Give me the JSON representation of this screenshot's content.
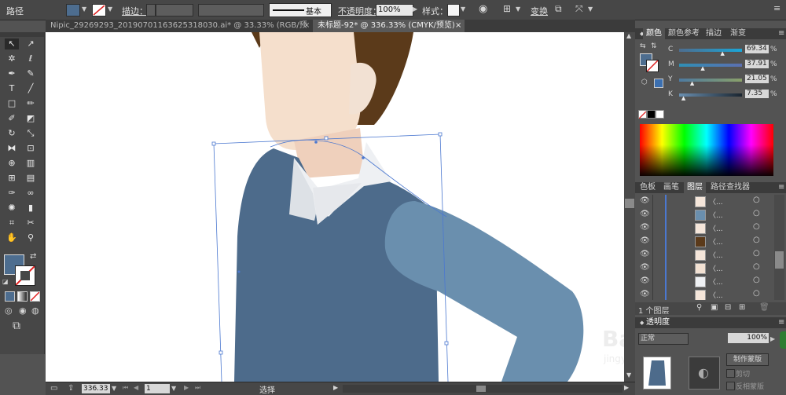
{
  "colors": {
    "accent_orange": "#f29a3a",
    "fill_swatch": "#4d6d8f",
    "sweater": "#4d6b8b",
    "sleeve": "#6a8fae",
    "hair": "#5b3a1a",
    "skin": "#f5dfcc",
    "collar": "#eef0f3",
    "selection": "#4b78d0"
  },
  "control_bar": {
    "object_type": "路径",
    "stroke_label": "描边：",
    "stroke_style": "基本",
    "opacity_label": "不透明度：",
    "opacity_value": "100%",
    "style_label": "样式：",
    "transform_label": "变换"
  },
  "tabs": [
    {
      "label": "Nipic_29269293_20190701163625318030.ai* @ 33.33% (RGB/预览)",
      "active": false
    },
    {
      "label": "未标题-92* @ 336.33% (CMYK/预览)",
      "active": true
    }
  ],
  "tools": [
    {
      "icon": "selection-tool-icon",
      "glyph": "↖"
    },
    {
      "icon": "direct-selection-tool-icon",
      "glyph": "↗"
    },
    {
      "icon": "magic-wand-tool-icon",
      "glyph": "✲"
    },
    {
      "icon": "lasso-tool-icon",
      "glyph": "ℓ"
    },
    {
      "icon": "pen-tool-icon",
      "glyph": "✒"
    },
    {
      "icon": "curvature-tool-icon",
      "glyph": "✎"
    },
    {
      "icon": "type-tool-icon",
      "glyph": "T"
    },
    {
      "icon": "line-tool-icon",
      "glyph": "╱"
    },
    {
      "icon": "rectangle-tool-icon",
      "glyph": "□"
    },
    {
      "icon": "paintbrush-tool-icon",
      "glyph": "✏"
    },
    {
      "icon": "pencil-tool-icon",
      "glyph": "✐"
    },
    {
      "icon": "eraser-tool-icon",
      "glyph": "◩"
    },
    {
      "icon": "rotate-tool-icon",
      "glyph": "↻"
    },
    {
      "icon": "scale-tool-icon",
      "glyph": "⤡"
    },
    {
      "icon": "width-tool-icon",
      "glyph": "⧓"
    },
    {
      "icon": "free-transform-tool-icon",
      "glyph": "⊡"
    },
    {
      "icon": "shape-builder-tool-icon",
      "glyph": "⊕"
    },
    {
      "icon": "perspective-grid-tool-icon",
      "glyph": "▥"
    },
    {
      "icon": "mesh-tool-icon",
      "glyph": "⊞"
    },
    {
      "icon": "gradient-tool-icon",
      "glyph": "▤"
    },
    {
      "icon": "eyedropper-tool-icon",
      "glyph": "✑"
    },
    {
      "icon": "blend-tool-icon",
      "glyph": "∞"
    },
    {
      "icon": "symbol-sprayer-tool-icon",
      "glyph": "✺"
    },
    {
      "icon": "column-graph-tool-icon",
      "glyph": "▮"
    },
    {
      "icon": "artboard-tool-icon",
      "glyph": "⌗"
    },
    {
      "icon": "slice-tool-icon",
      "glyph": "✂"
    },
    {
      "icon": "hand-tool-icon",
      "glyph": "✋"
    },
    {
      "icon": "zoom-tool-icon",
      "glyph": "⚲"
    }
  ],
  "color_panel": {
    "tabs": [
      "颜色",
      "颜色参考",
      "描边",
      "渐变"
    ],
    "channels": [
      {
        "name": "C",
        "value": "69.34",
        "percent": 69.34
      },
      {
        "name": "M",
        "value": "37.91",
        "percent": 37.91
      },
      {
        "name": "Y",
        "value": "21.05",
        "percent": 21.05
      },
      {
        "name": "K",
        "value": "7.35",
        "percent": 7.35
      }
    ]
  },
  "layers_panel": {
    "tabs": [
      "色板",
      "画笔",
      "图层",
      "路径查找器"
    ],
    "rows": [
      "〈...",
      "〈...",
      "〈...",
      "〈...",
      "〈...",
      "〈...",
      "〈...",
      "〈..."
    ],
    "layer_count": "1 个图层"
  },
  "transparency_panel": {
    "title": "透明度",
    "blend_mode": "正常",
    "opacity": "100%",
    "make_mask": "制作蒙版",
    "clip_label": "剪切",
    "invert_mask_label": "反相蒙版"
  },
  "status_bar": {
    "zoom": "336.33",
    "page": "1",
    "tool_name": "选择"
  },
  "watermark": {
    "text": "Bai 经验",
    "url": "jingyan.baidu.com"
  }
}
